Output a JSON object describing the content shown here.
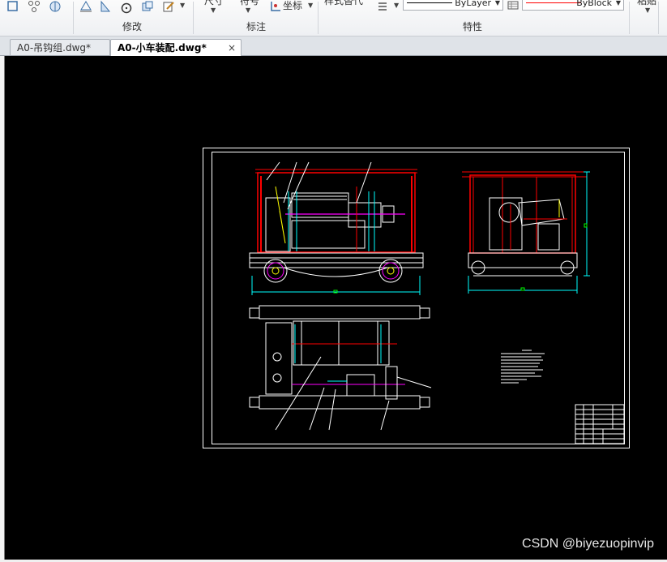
{
  "ribbon": {
    "panels": [
      {
        "label": "修改"
      },
      {
        "label": "标注"
      },
      {
        "label": "特性"
      }
    ],
    "labels": {
      "size": "尺寸",
      "text": "符号",
      "coord": "坐标",
      "layer_style": "样式替代",
      "far_right": "粘贴"
    },
    "properties": {
      "linetype_value": "ByLayer",
      "color_value": "ByBlock",
      "color_line": "#ff0000"
    }
  },
  "tabs": [
    {
      "label": "A0-吊钩组.dwg*",
      "active": false
    },
    {
      "label": "A0-小车装配.dwg*",
      "active": true,
      "close": "×"
    }
  ],
  "colors": {
    "canvas_bg": "#000000",
    "frame": "#ffffff",
    "red": "#ff0000",
    "cyan": "#00ffff",
    "magenta": "#ff00ff",
    "green": "#00ff00",
    "yellow": "#ffff00"
  },
  "watermark": "CSDN @biyezuopinvip"
}
